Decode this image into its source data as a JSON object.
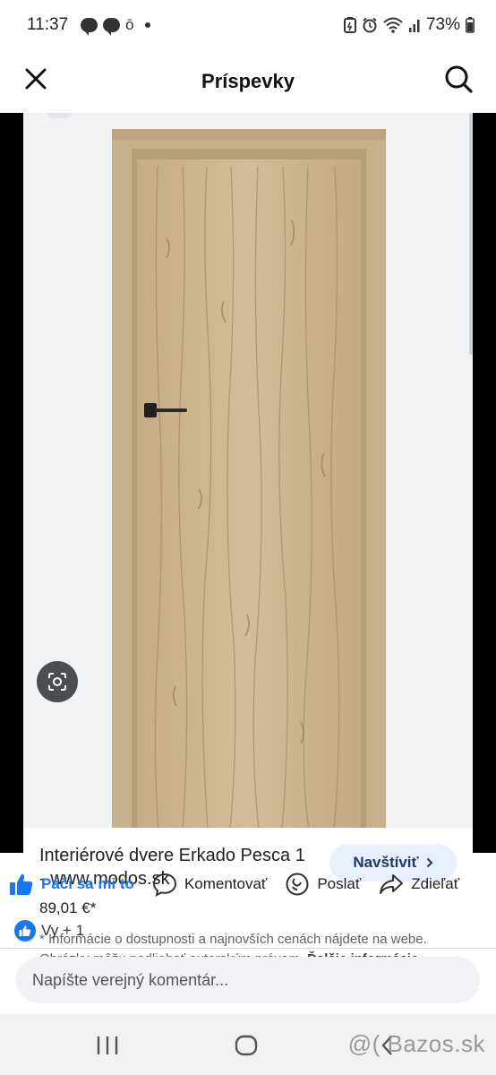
{
  "status_bar": {
    "time": "11:37",
    "o_glyph": "ō",
    "battery": "73%",
    "icons": [
      "messenger-icon",
      "messenger-icon",
      "dot-icon",
      "battery-saver-icon",
      "alarm-icon",
      "wifi-icon",
      "signal-icon",
      "battery-icon"
    ]
  },
  "header": {
    "title": "Príspevky",
    "close_icon": "close-icon",
    "search_icon": "search-icon"
  },
  "image_result": {
    "product_title": "Interiérové dvere Erkado Pesca 1 - www.modos.sk",
    "visit_label": "Navštíviť",
    "price": "89,01 €*",
    "disclaimer": "* Informácie o dostupnosti a najnovších cenách nájdete na webe. Obrázky môžu podliehať autorským právam.",
    "disclaimer_more": "Ďalšie informácie"
  },
  "actions": {
    "like": "Páči sa mi to",
    "comment": "Komentovať",
    "send": "Poslať",
    "share": "Zdieľať"
  },
  "reactions": {
    "text": "Vy + 1"
  },
  "comment_input": {
    "placeholder": "Napíšte verejný komentár..."
  },
  "watermark": "@( Bazos.sk",
  "colors": {
    "brand": "#1877f2",
    "door_wood": "#c9b08c",
    "visit_bg": "#e8effd"
  }
}
